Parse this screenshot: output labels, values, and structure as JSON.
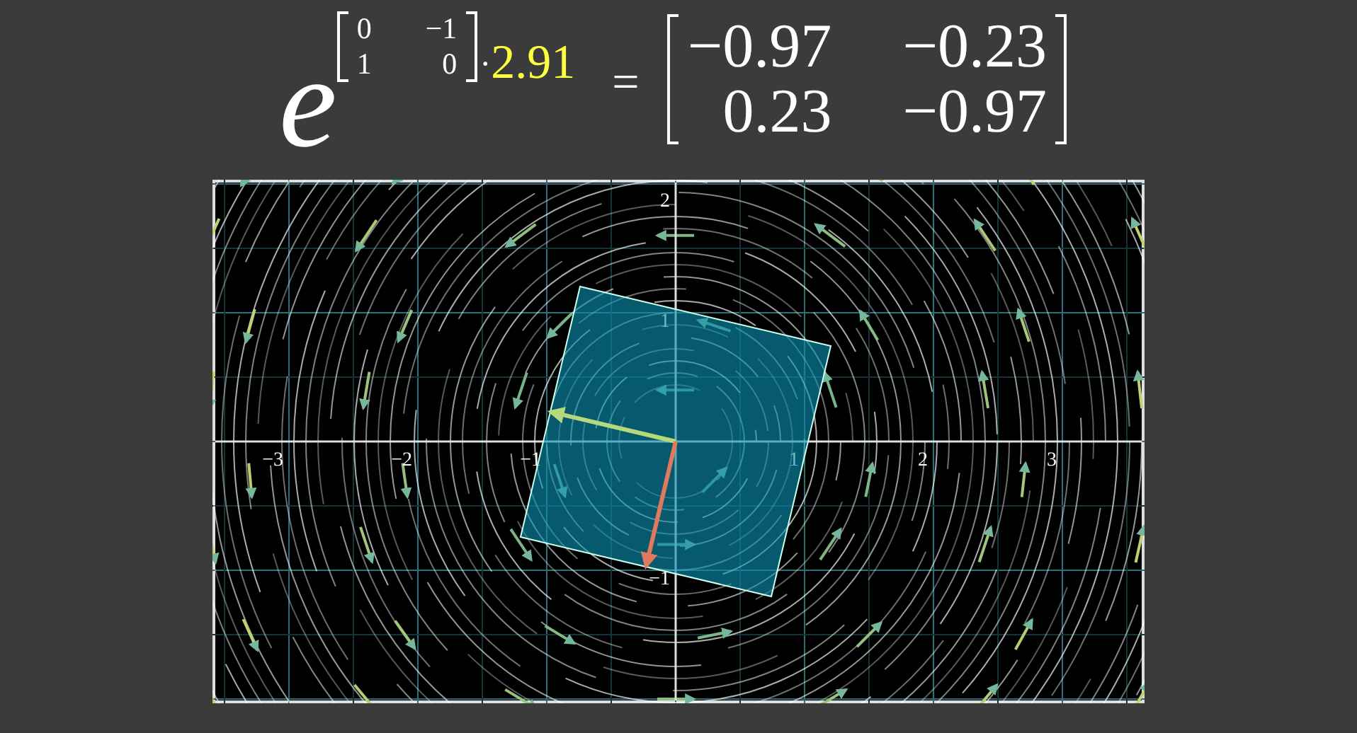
{
  "equation": {
    "base": "e",
    "exponent_matrix": [
      [
        "0",
        "−1"
      ],
      [
        "1",
        "0"
      ]
    ],
    "dot": "·",
    "scalar": "2.91",
    "equals": "=",
    "result_matrix": [
      [
        "−0.97",
        "−0.23"
      ],
      [
        "0.23",
        "−0.97"
      ]
    ]
  },
  "plot": {
    "x_ticks": [
      "−3",
      "−2",
      "−1",
      "1",
      "2",
      "3"
    ],
    "y_ticks": [
      "2",
      "1",
      "−1"
    ]
  }
}
